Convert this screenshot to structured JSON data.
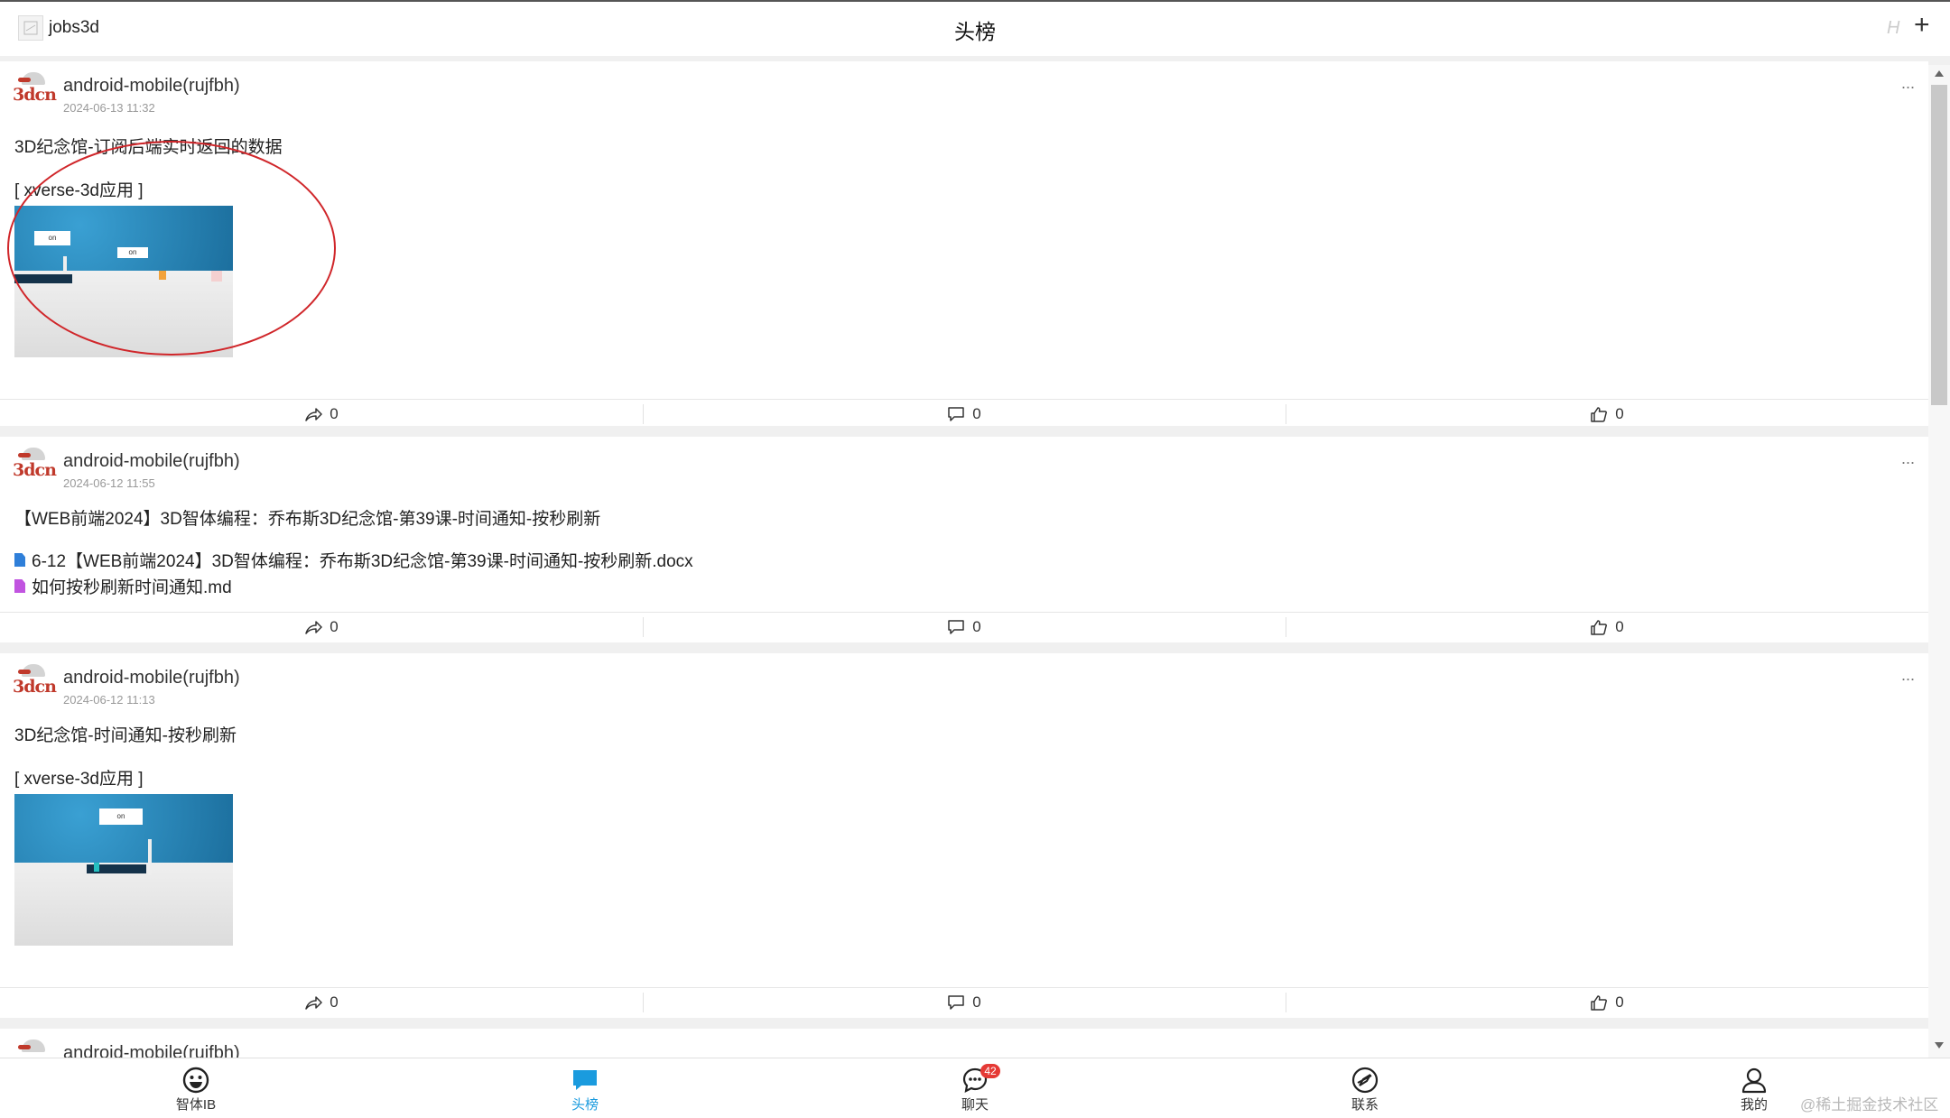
{
  "header": {
    "username": "jobs3d",
    "title": "头榜",
    "h_label": "H",
    "plus_label": "+"
  },
  "posts": [
    {
      "author": "android-mobile(rujfbh)",
      "time": "2024-06-13 11:32",
      "text": "3D纪念馆-订阅后端实时返回的数据",
      "app_tag": "[ xverse-3d应用 ]",
      "share_count": "0",
      "comment_count": "0",
      "like_count": "0"
    },
    {
      "author": "android-mobile(rujfbh)",
      "time": "2024-06-12 11:55",
      "text": "【WEB前端2024】3D智体编程：乔布斯3D纪念馆-第39课-时间通知-按秒刷新",
      "attachments": [
        "6-12【WEB前端2024】3D智体编程：乔布斯3D纪念馆-第39课-时间通知-按秒刷新.docx",
        "如何按秒刷新时间通知.md"
      ],
      "share_count": "0",
      "comment_count": "0",
      "like_count": "0"
    },
    {
      "author": "android-mobile(rujfbh)",
      "time": "2024-06-12 11:13",
      "text": "3D纪念馆-时间通知-按秒刷新",
      "app_tag": "[ xverse-3d应用 ]",
      "share_count": "0",
      "comment_count": "0",
      "like_count": "0"
    },
    {
      "author": "android-mobile(rujfbh)"
    }
  ],
  "avatar_logo": "3dcn",
  "thumb_sign": "on",
  "more_label": "...",
  "nav": [
    {
      "label": "智体IB",
      "icon": "smiley-icon"
    },
    {
      "label": "头榜",
      "icon": "chat-bubble-icon"
    },
    {
      "label": "聊天",
      "icon": "chat-dots-icon",
      "badge": "42"
    },
    {
      "label": "联系",
      "icon": "compass-icon"
    },
    {
      "label": "我的",
      "icon": "person-icon"
    }
  ],
  "watermark": "@稀土掘金技术社区",
  "colors": {
    "accent": "#1a9bde",
    "badge": "#e53935",
    "annotation": "#d0262a",
    "logo": "#c0392b"
  }
}
